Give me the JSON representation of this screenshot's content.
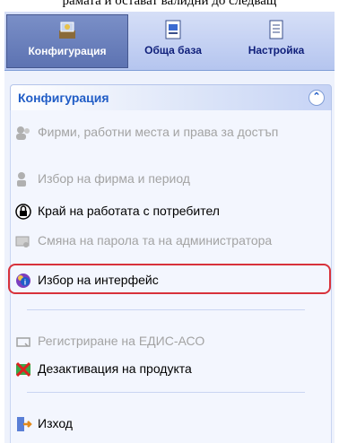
{
  "caption": "рамата и остават валидни до следващ",
  "toolbar": {
    "buttons": [
      {
        "label": "Конфигурация",
        "active": true,
        "icon": "configuration-icon"
      },
      {
        "label": "Обща база",
        "active": false,
        "icon": "database-icon"
      },
      {
        "label": "Настройка",
        "active": false,
        "icon": "settings-icon"
      }
    ]
  },
  "panel": {
    "title": "Конфигурация",
    "collapse_icon": "double-chevron-up-icon"
  },
  "items": [
    {
      "label": "Фирми, работни места и права за достъп",
      "enabled": false,
      "icon": "users-icon"
    },
    {
      "label": "Избор на фирма и период",
      "enabled": false,
      "icon": "company-icon"
    },
    {
      "label": "Край на работата с потребител",
      "enabled": true,
      "icon": "lock-icon"
    },
    {
      "label": "Смяна на парола та на администратора",
      "enabled": false,
      "icon": "password-icon"
    },
    {
      "label": "Избор на интерфейс",
      "enabled": true,
      "icon": "interface-icon",
      "highlighted": true
    },
    {
      "label": "Регистриране на ЕДИС-АСО",
      "enabled": false,
      "icon": "register-icon"
    },
    {
      "label": "Дезактивация на продукта",
      "enabled": true,
      "icon": "deactivate-icon"
    },
    {
      "label": "Изход",
      "enabled": true,
      "icon": "exit-icon"
    }
  ],
  "colors": {
    "accent": "#215dc6",
    "highlight": "#d8323b",
    "disabled": "#a3a3a3"
  }
}
